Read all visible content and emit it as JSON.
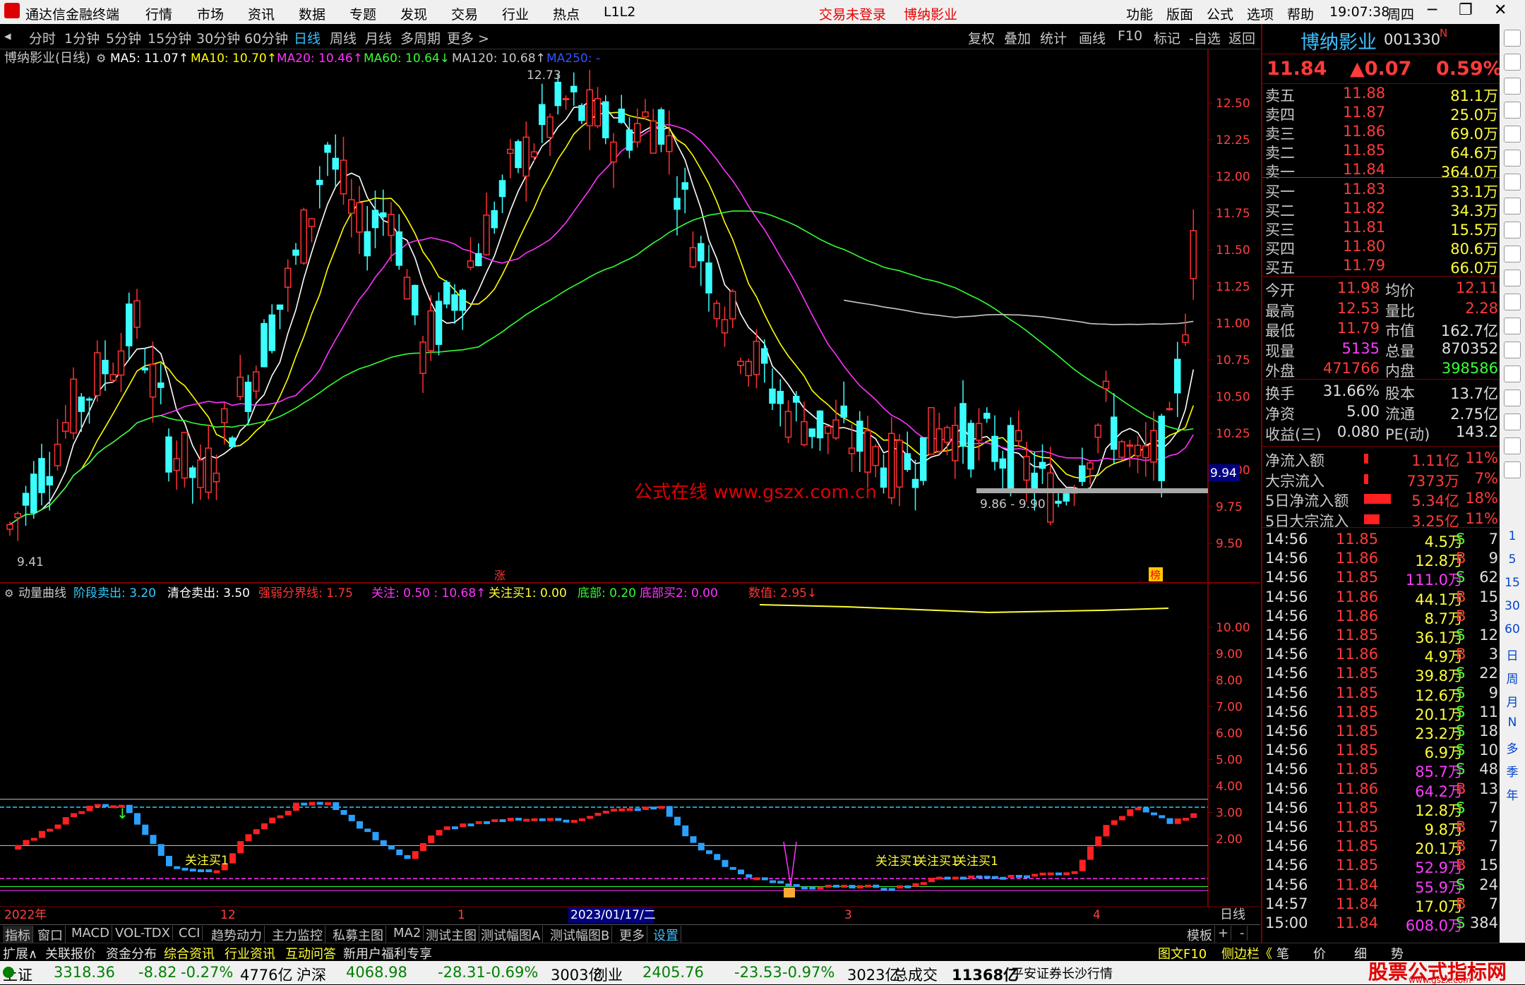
{
  "window": {
    "app_title": "通达信金融终端",
    "menus": [
      "行情",
      "市场",
      "资讯",
      "数据",
      "专题",
      "发现",
      "交易",
      "行业",
      "热点",
      "L1L2"
    ],
    "notice": "交易未登录",
    "stock_name_title": "博纳影业",
    "right_menus": [
      "功能",
      "版面",
      "公式",
      "选项",
      "帮助"
    ],
    "time": "19:07:38",
    "weekday": "周四"
  },
  "period_bar": {
    "periods": [
      "分时",
      "1分钟",
      "5分钟",
      "15分钟",
      "30分钟",
      "60分钟",
      "日线",
      "周线",
      "月线",
      "多周期",
      "更多 >"
    ],
    "active": "日线",
    "actions": [
      "复权",
      "叠加",
      "统计",
      "画线",
      "F10",
      "标记",
      "-自选",
      "返回"
    ]
  },
  "main_chart": {
    "title": "博纳影业(日线)",
    "ma_labels": [
      {
        "text": "MA5: 11.07↑",
        "color": "#ffffff"
      },
      {
        "text": "MA10: 10.70↑",
        "color": "#ffff00"
      },
      {
        "text": "MA20: 10.46↑",
        "color": "#ff33ff"
      },
      {
        "text": "MA60: 10.64↓",
        "color": "#33ff33"
      },
      {
        "text": "MA120: 10.68↑",
        "color": "#c8c8c8"
      },
      {
        "text": "MA250: -",
        "color": "#3355ff"
      }
    ],
    "price_ticks": [
      "12.50",
      "12.25",
      "12.00",
      "11.75",
      "11.50",
      "11.25",
      "11.00",
      "10.75",
      "10.50",
      "10.25",
      "10.00",
      "9.75",
      "9.50"
    ],
    "high_label": "12.73",
    "low_label": "9.41",
    "range_label": "9.86 - 9.90",
    "current_price_tag": "9.94",
    "watermark": "公式在线  www.gszx.com.cn",
    "zhang_tag": "涨",
    "bang_tag": "榜"
  },
  "indicator": {
    "labels": [
      {
        "text": "动量曲线",
        "color": "#c8c8c8"
      },
      {
        "text": "阶段卖出: 3.20",
        "color": "#33ccff"
      },
      {
        "text": "清仓卖出: 3.50",
        "color": "#ffffff"
      },
      {
        "text": "强弱分界线: 1.75",
        "color": "#ff3333"
      },
      {
        "text": "关注: 0.50 : 10.68↑",
        "color": "#ff33ff"
      },
      {
        "text": "关注买1: 0.00",
        "color": "#ffff33"
      },
      {
        "text": "底部: 0.20",
        "color": "#33ff33"
      },
      {
        "text": "底部买2: 0.00",
        "color": "#ff33ff"
      },
      {
        "text": "数值: 2.95↓",
        "color": "#ff3333"
      }
    ],
    "ticks": [
      "10.00",
      "9.00",
      "8.00",
      "7.00",
      "6.00",
      "5.00",
      "4.00",
      "3.00",
      "2.00"
    ],
    "signal_labels": [
      "关注买1",
      "关注买1",
      "关注买1",
      "关注买1"
    ]
  },
  "date_axis": {
    "labels": [
      "2022年",
      "12",
      "1",
      "2023/01/17/二",
      "3",
      "4"
    ],
    "period": "日线"
  },
  "bottom_tabs": [
    "指标",
    "窗口",
    "MACD",
    "VOL-TDX",
    "CCI",
    "趋势动力",
    "主力监控",
    "私募主图",
    "MA2",
    "测试主图",
    "测试幅图A",
    "测试幅图B",
    "更多",
    "设置"
  ],
  "bottom_tab_right": [
    "模板",
    "+",
    "-"
  ],
  "news_bar": [
    "扩展∧",
    "关联报价",
    "资金分布",
    "综合资讯",
    "行业资讯",
    "互动问答",
    "新用户福利专享"
  ],
  "news_bar_right": [
    "图文F10",
    "侧边栏《",
    "笔",
    "价",
    "细",
    "势"
  ],
  "status_bar": {
    "indexes": [
      {
        "name": "上证",
        "value": "3318.36",
        "chg": "-8.82",
        "pct": "-0.27%",
        "amt": "4776亿"
      },
      {
        "name": "沪深",
        "value": "4068.98",
        "chg": "-28.31",
        "pct": "-0.69%",
        "amt": "3003亿"
      },
      {
        "name": "创业",
        "value": "2405.76",
        "chg": "-23.53",
        "pct": "-0.97%",
        "amt": "3023亿"
      }
    ],
    "total_label": "总成交",
    "total_value": "11368亿",
    "broker": "平安证券长沙行情",
    "logo_text": "股票公式指标网",
    "logo_url": "www.gszx.com"
  },
  "quote_panel": {
    "name": "博纳影业",
    "code": "001330",
    "flag": "N",
    "price": "11.84",
    "change": "▲0.07",
    "pct": "0.59%",
    "asks": [
      {
        "label": "卖五",
        "price": "11.88",
        "vol": "81.1万"
      },
      {
        "label": "卖四",
        "price": "11.87",
        "vol": "25.0万"
      },
      {
        "label": "卖三",
        "price": "11.86",
        "vol": "69.0万"
      },
      {
        "label": "卖二",
        "price": "11.85",
        "vol": "64.6万"
      },
      {
        "label": "卖一",
        "price": "11.84",
        "vol": "364.0万"
      }
    ],
    "bids": [
      {
        "label": "买一",
        "price": "11.83",
        "vol": "33.1万"
      },
      {
        "label": "买二",
        "price": "11.82",
        "vol": "34.3万"
      },
      {
        "label": "买三",
        "price": "11.81",
        "vol": "15.5万"
      },
      {
        "label": "买四",
        "price": "11.80",
        "vol": "80.6万"
      },
      {
        "label": "买五",
        "price": "11.79",
        "vol": "66.0万"
      }
    ],
    "stats": [
      {
        "l1": "今开",
        "v1": "11.98",
        "l2": "均价",
        "v2": "12.11",
        "c1": "up",
        "c2": "up"
      },
      {
        "l1": "最高",
        "v1": "12.53",
        "l2": "量比",
        "v2": "2.28",
        "c1": "up",
        "c2": "up"
      },
      {
        "l1": "最低",
        "v1": "11.79",
        "l2": "市值",
        "v2": "162.7亿",
        "c1": "up",
        "c2": "wh"
      },
      {
        "l1": "现量",
        "v1": "5135",
        "l2": "总量",
        "v2": "870352",
        "c1": "mag",
        "c2": "wh"
      },
      {
        "l1": "外盘",
        "v1": "471766",
        "l2": "内盘",
        "v2": "398586",
        "c1": "up",
        "c2": "dn"
      }
    ],
    "stats2": [
      {
        "l1": "换手",
        "v1": "31.66%",
        "l2": "股本",
        "v2": "13.7亿"
      },
      {
        "l1": "净资",
        "v1": "5.00",
        "l2": "流通",
        "v2": "2.75亿"
      },
      {
        "l1": "收益(三)",
        "v1": "0.080",
        "l2": "PE(动)",
        "v2": "143.2"
      }
    ],
    "flows": [
      {
        "label": "净流入额",
        "value": "1.11亿",
        "pct": "11%",
        "bar": 0.03
      },
      {
        "label": "大宗流入",
        "value": "7373万",
        "pct": "7%",
        "bar": 0.02
      },
      {
        "label": "5日净流入额",
        "value": "5.34亿",
        "pct": "18%",
        "bar": 0.38
      },
      {
        "label": "5日大宗流入",
        "value": "3.25亿",
        "pct": "11%",
        "bar": 0.22
      }
    ],
    "ticks": [
      {
        "t": "14:56",
        "p": "11.85",
        "v": "4.5万",
        "bs": "S",
        "n": "7"
      },
      {
        "t": "14:56",
        "p": "11.86",
        "v": "12.8万",
        "bs": "B",
        "n": "9"
      },
      {
        "t": "14:56",
        "p": "11.85",
        "v": "111.0万",
        "bs": "S",
        "n": "62"
      },
      {
        "t": "14:56",
        "p": "11.86",
        "v": "44.1万",
        "bs": "B",
        "n": "15"
      },
      {
        "t": "14:56",
        "p": "11.86",
        "v": "8.7万",
        "bs": "B",
        "n": "3"
      },
      {
        "t": "14:56",
        "p": "11.85",
        "v": "36.1万",
        "bs": "S",
        "n": "12"
      },
      {
        "t": "14:56",
        "p": "11.86",
        "v": "4.9万",
        "bs": "B",
        "n": "3"
      },
      {
        "t": "14:56",
        "p": "11.85",
        "v": "39.8万",
        "bs": "S",
        "n": "22"
      },
      {
        "t": "14:56",
        "p": "11.85",
        "v": "12.6万",
        "bs": "S",
        "n": "9"
      },
      {
        "t": "14:56",
        "p": "11.85",
        "v": "20.1万",
        "bs": "S",
        "n": "11"
      },
      {
        "t": "14:56",
        "p": "11.85",
        "v": "23.2万",
        "bs": "S",
        "n": "18"
      },
      {
        "t": "14:56",
        "p": "11.85",
        "v": "6.9万",
        "bs": "S",
        "n": "10"
      },
      {
        "t": "14:56",
        "p": "11.85",
        "v": "85.7万",
        "bs": "S",
        "n": "48"
      },
      {
        "t": "14:56",
        "p": "11.86",
        "v": "64.2万",
        "bs": "B",
        "n": "13"
      },
      {
        "t": "14:56",
        "p": "11.85",
        "v": "12.8万",
        "bs": "S",
        "n": "7"
      },
      {
        "t": "14:56",
        "p": "11.85",
        "v": "9.8万",
        "bs": "B",
        "n": "7"
      },
      {
        "t": "14:56",
        "p": "11.85",
        "v": "20.1万",
        "bs": "B",
        "n": "7"
      },
      {
        "t": "14:56",
        "p": "11.85",
        "v": "52.9万",
        "bs": "B",
        "n": "15"
      },
      {
        "t": "14:56",
        "p": "11.84",
        "v": "55.9万",
        "bs": "S",
        "n": "24"
      },
      {
        "t": "14:57",
        "p": "11.84",
        "v": "17.0万",
        "bs": "B",
        "n": "7"
      },
      {
        "t": "15:00",
        "p": "11.84",
        "v": "608.0万",
        "bs": "S",
        "n": "384"
      }
    ],
    "side_buttons": [
      "1",
      "5",
      "15",
      "30",
      "60",
      "日",
      "周",
      "月",
      "N",
      "多",
      "季",
      "年"
    ]
  }
}
